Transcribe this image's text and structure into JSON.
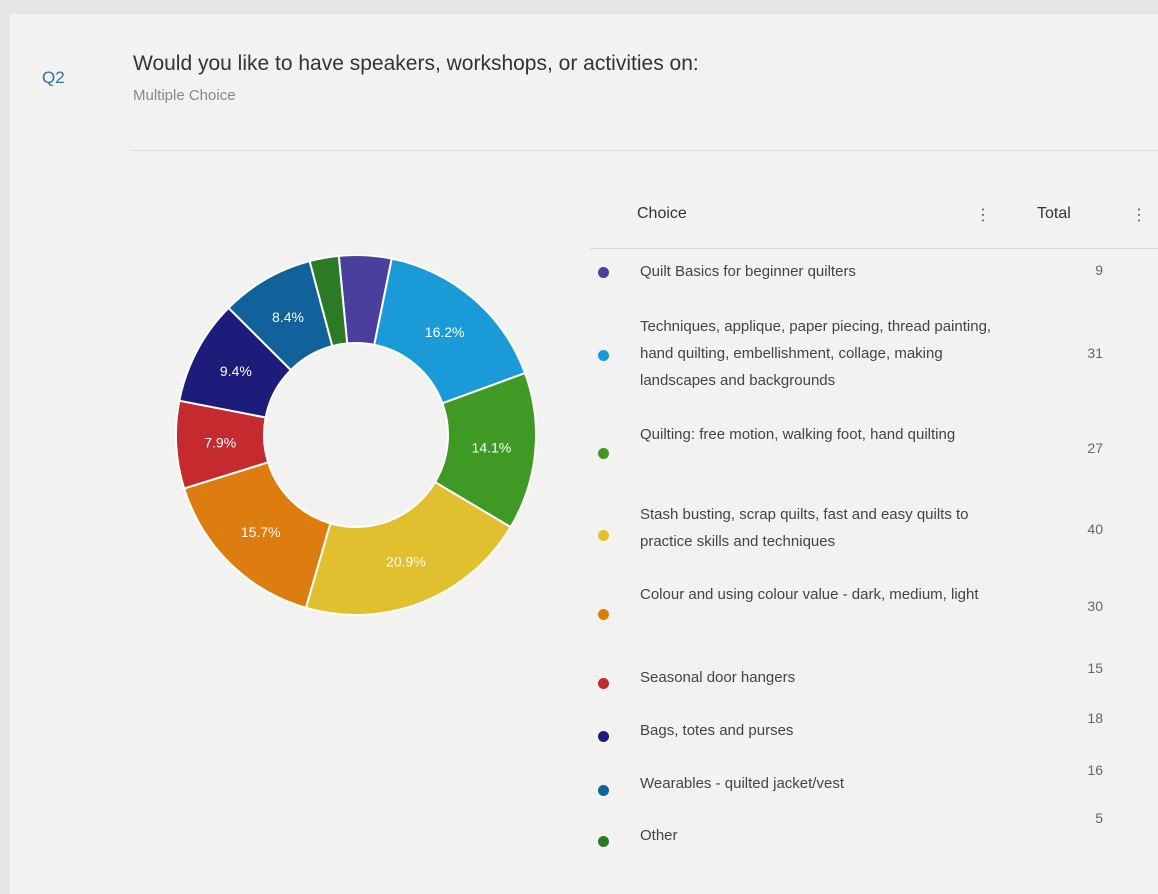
{
  "question": {
    "number": "Q2",
    "title": "Would you like to have speakers, workshops, or activities on:",
    "type": "Multiple Choice"
  },
  "table": {
    "choice_header": "Choice",
    "total_header": "Total"
  },
  "chart_data": {
    "type": "pie",
    "style": "donut",
    "categories": [
      "Quilt Basics for beginner quilters",
      "Techniques, applique, paper piecing, thread painting, hand quilting, embellishment, collage, making landscapes and backgrounds",
      "Quilting: free motion, walking foot, hand quilting",
      "Stash busting, scrap quilts, fast and easy quilts to practice skills and techniques",
      "Colour and using colour value - dark, medium, light",
      "Seasonal door hangers",
      "Bags, totes and purses",
      "Wearables - quilted jacket/vest",
      "Other"
    ],
    "values": [
      9,
      31,
      27,
      40,
      30,
      15,
      18,
      16,
      5
    ],
    "slice_labels": [
      "",
      "16.2%",
      "14.1%",
      "20.9%",
      "15.7%",
      "7.9%",
      "9.4%",
      "8.4%",
      ""
    ],
    "colors": [
      "#4b3f9e",
      "#1a9ad6",
      "#3f9a25",
      "#e1c030",
      "#dd7d10",
      "#c52b2e",
      "#1e1c7a",
      "#11619a",
      "#2d7a26"
    ]
  }
}
